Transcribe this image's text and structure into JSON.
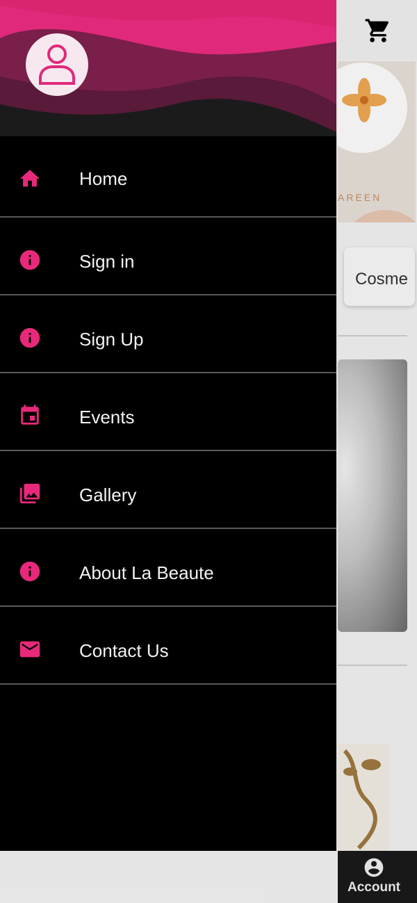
{
  "app": {
    "banner_brand": "AREEN",
    "chip_label": "Cosme",
    "account_label": "Account"
  },
  "colors": {
    "accent": "#e8297b",
    "drawer_bg": "#000000",
    "menu_text": "#f2f2f2"
  },
  "drawer": {
    "menu": [
      {
        "label": "Home",
        "icon": "home-icon"
      },
      {
        "label": "Sign in",
        "icon": "info-icon"
      },
      {
        "label": "Sign Up",
        "icon": "info-icon"
      },
      {
        "label": "Events",
        "icon": "event-icon"
      },
      {
        "label": "Gallery",
        "icon": "gallery-icon"
      },
      {
        "label": "About La Beaute",
        "icon": "info-icon"
      },
      {
        "label": "Contact Us",
        "icon": "mail-icon"
      }
    ]
  }
}
